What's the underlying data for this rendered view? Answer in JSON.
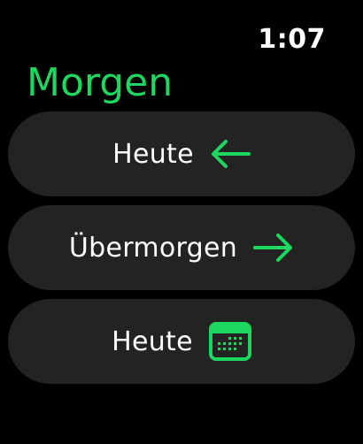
{
  "status": {
    "time": "1:07"
  },
  "header": {
    "title": "Morgen"
  },
  "colors": {
    "accent": "#1ed760",
    "background": "#000000",
    "pill": "#232323",
    "text": "#ffffff"
  },
  "options": [
    {
      "label": "Heute",
      "icon": "arrow-left-icon"
    },
    {
      "label": "Übermorgen",
      "icon": "arrow-right-icon"
    },
    {
      "label": "Heute",
      "icon": "calendar-icon"
    }
  ]
}
